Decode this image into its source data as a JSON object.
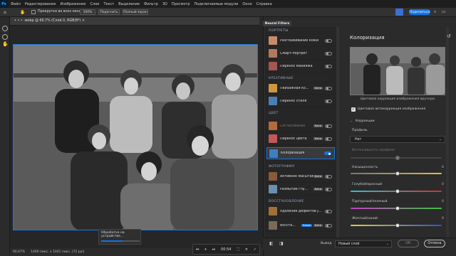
{
  "menu": {
    "logo": "Ps",
    "items": [
      "Файл",
      "Редактирование",
      "Изображение",
      "Слои",
      "Текст",
      "Выделение",
      "Фильтр",
      "3D",
      "Просмотр",
      "Подключаемые модули",
      "Окно",
      "Справка"
    ]
  },
  "options": {
    "scroll_all": "Прокрутка во всех окнах",
    "zoom": "100%",
    "fit": "Подогнать",
    "fill_screen": "Полный экран",
    "share": "Поделиться"
  },
  "document": {
    "tab_title": "• • • .webp @ 66,7% (Слой 0, RGB/8*) ×",
    "zoom_status": "66,67%",
    "size_status": "1469 пикс. x 1041 пикс. (72 ppi)"
  },
  "progress": {
    "label": "Обработка на устройстве...",
    "fraction": 0.55
  },
  "player": {
    "time": "00:54"
  },
  "neural_filters": {
    "tab": "Neural Filters",
    "categories": {
      "portraits": "ПОРТРЕТЫ",
      "creative": "КРЕАТИВНЫЕ",
      "color": "ЦВЕТ",
      "photo": "ФОТОГРАФИЯ",
      "restore": "ВОССТАНОВЛЕНИЕ"
    },
    "filters": [
      {
        "label": "Разглаживание кожи",
        "badge": "",
        "on": false
      },
      {
        "label": "Смарт-портрет",
        "badge": "",
        "on": false
      },
      {
        "label": "Перенос макияжа",
        "badge": "",
        "on": false
      },
      {
        "label": "Пейзажная ко...",
        "badge": "Бета",
        "on": false
      },
      {
        "label": "Перенос стиля",
        "badge": "",
        "on": false
      },
      {
        "label": "Согласование",
        "badge": "Бета",
        "on": false
      },
      {
        "label": "Перенос цвета",
        "badge": "Бета",
        "on": false
      },
      {
        "label": "Колоризация",
        "badge": "",
        "on": true
      },
      {
        "label": "Активное масштабир.",
        "badge": "Бета",
        "on": false
      },
      {
        "label": "Размытие глу...",
        "badge": "Бета",
        "on": false
      },
      {
        "label": "Удаление дефектов J...",
        "badge": "",
        "on": false
      },
      {
        "label": "Восста...",
        "badge": "Бета",
        "badge2": "Новое",
        "on": false
      }
    ]
  },
  "settings": {
    "title": "Колоризация",
    "caption": "Цветовая коррекция изображения вручную",
    "auto_label": "Цветовая автокоррекция изображения",
    "auto_checked": true,
    "corrections": "Коррекции",
    "profile_label": "Профиль",
    "profile_value": "Нет",
    "profile_strength": "Интенсивность профиля",
    "sliders": [
      {
        "label": "Насыщенность",
        "value": "0",
        "pos": 0.5
      },
      {
        "label": "Голубой/красный",
        "value": "0",
        "pos": 0.5
      },
      {
        "label": "Пурпурный/зеленый",
        "value": "0",
        "pos": 0.5
      },
      {
        "label": "Желтый/синий",
        "value": "0",
        "pos": 0.5
      }
    ]
  },
  "output": {
    "label": "Вывод",
    "value": "Новый слой",
    "ok": "ОК",
    "cancel": "Отмена"
  }
}
